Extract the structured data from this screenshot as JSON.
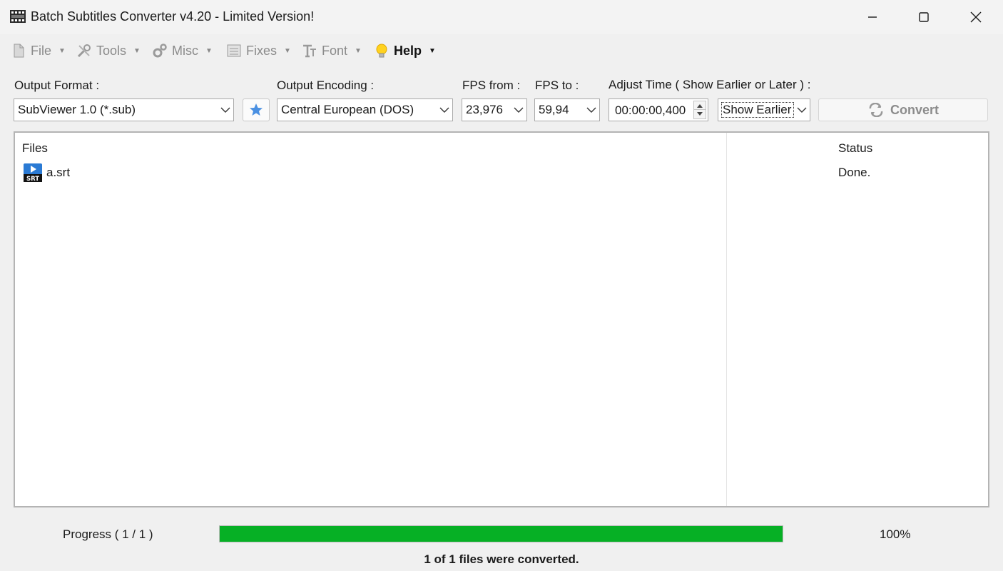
{
  "window": {
    "title": "Batch Subtitles Converter v4.20 - Limited Version!"
  },
  "menu": {
    "items": [
      {
        "label": "File",
        "icon": "file-icon"
      },
      {
        "label": "Tools",
        "icon": "tools-icon"
      },
      {
        "label": "Misc",
        "icon": "gears-icon"
      },
      {
        "label": "Fixes",
        "icon": "list-icon"
      },
      {
        "label": "Font",
        "icon": "font-icon"
      },
      {
        "label": "Help",
        "icon": "lightbulb-icon"
      }
    ]
  },
  "controls": {
    "output_format_label": "Output Format :",
    "output_format_value": "SubViewer 1.0 (*.sub)",
    "output_encoding_label": "Output Encoding :",
    "output_encoding_value": "Central European (DOS)",
    "fps_from_label": "FPS from :",
    "fps_from_value": "23,976",
    "fps_to_label": "FPS to :",
    "fps_to_value": "59,94",
    "adjust_time_label": "Adjust Time ( Show Earlier or Later ) :",
    "adjust_time_value": "00:00:00,400",
    "direction_value": "Show Earlier",
    "convert_label": "Convert"
  },
  "files": {
    "columns": {
      "files": "Files",
      "status": "Status"
    },
    "rows": [
      {
        "name": "a.srt",
        "status": "Done.",
        "icon": "srt-file-icon"
      }
    ]
  },
  "progress": {
    "label": "Progress ( 1 / 1 )",
    "percent_text": "100%",
    "fraction": 1.0,
    "message": "1 of 1 files were converted."
  },
  "colors": {
    "progress_fill": "#06b025",
    "star": "#4a90e2"
  }
}
